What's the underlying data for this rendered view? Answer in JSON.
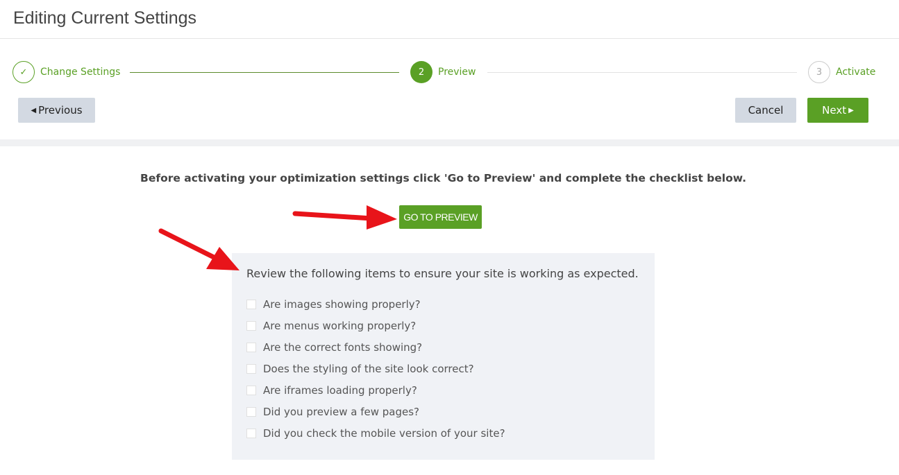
{
  "header": {
    "title": "Editing Current Settings"
  },
  "steps": [
    {
      "label": "Change Settings",
      "marker": "✓",
      "state": "done"
    },
    {
      "label": "Preview",
      "marker": "2",
      "state": "active"
    },
    {
      "label": "Activate",
      "marker": "3",
      "state": "pending"
    }
  ],
  "nav": {
    "previous": "Previous",
    "cancel": "Cancel",
    "next": "Next"
  },
  "main": {
    "instruction": "Before activating your optimization settings click 'Go to Preview' and complete the checklist below.",
    "go_to_preview": "GO TO PREVIEW",
    "checklist_heading": "Review the following items to ensure your site is working as expected.",
    "checklist": [
      "Are images showing properly?",
      "Are menus working properly?",
      "Are the correct fonts showing?",
      "Does the styling of the site look correct?",
      "Are iframes loading properly?",
      "Did you preview a few pages?",
      "Did you check the mobile version of your site?"
    ]
  },
  "colors": {
    "accent": "#5aa025",
    "annotation_arrow": "#e8141a"
  }
}
